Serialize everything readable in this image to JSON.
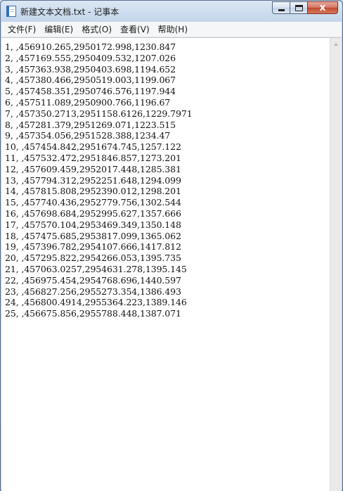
{
  "window": {
    "title": "新建文本文档.txt - 记事本",
    "close_glyph": "x"
  },
  "menu": [
    {
      "label": "文件(F)"
    },
    {
      "label": "编辑(E)"
    },
    {
      "label": "格式(O)"
    },
    {
      "label": "查看(V)"
    },
    {
      "label": "帮助(H)"
    }
  ],
  "document": {
    "lines": [
      "1, ,456910.265,2950172.998,1230.847",
      "2, ,457169.555,2950409.532,1207.026",
      "3, ,457363.938,2950403.698,1194.652",
      "4, ,457380.466,2950519.003,1199.067",
      "5, ,457458.351,2950746.576,1197.944",
      "6, ,457511.089,2950900.766,1196.67",
      "7, ,457350.2713,2951158.6126,1229.7971",
      "8, ,457281.379,2951269.071,1223.515",
      "9, ,457354.056,2951528.388,1234.47",
      "10, ,457454.842,2951674.745,1257.122",
      "11, ,457532.472,2951846.857,1273.201",
      "12, ,457609.459,2952017.448,1285.381",
      "13, ,457794.312,2952251.648,1294.099",
      "14, ,457815.808,2952390.012,1298.201",
      "15, ,457740.436,2952779.756,1302.544",
      "16, ,457698.684,2952995.627,1357.666",
      "17, ,457570.104,2953469.349,1350.148",
      "18, ,457475.685,2953817.099,1365.062",
      "19, ,457396.782,2954107.666,1417.812",
      "20, ,457295.822,2954266.053,1395.735",
      "21, ,457063.0257,2954631.278,1395.145",
      "22, ,456975.454,2954768.696,1440.597",
      "23, ,456827.256,2955273.354,1386.493",
      "24, ,456800.4914,2955364.223,1389.146",
      "25, ,456675.856,2955788.448,1387.071"
    ]
  },
  "icons": {
    "app": "notepad-icon",
    "minimize": "minimize-icon",
    "maximize": "maximize-icon",
    "close": "close-icon",
    "scroll_up": "scroll-up-arrow-icon"
  }
}
